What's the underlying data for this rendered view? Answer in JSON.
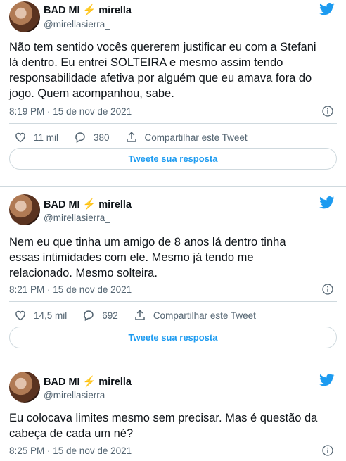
{
  "tweets": [
    {
      "display_name": "BAD MI",
      "emoji": "⚡",
      "display_name_suffix": "mirella",
      "handle": "@mirellasierra_",
      "text": "Não tem sentido vocês quererem justificar eu com a Stefani lá dentro. Eu entrei SOLTEIRA e mesmo assim tendo responsabilidade afetiva por alguém que eu amava fora do jogo. Quem acompanhou, sabe.",
      "timestamp": "8:19 PM · 15 de nov de 2021",
      "likes": "11 mil",
      "replies": "380",
      "share_label": "Compartilhar este Tweet",
      "reply_button": "Tweete sua resposta"
    },
    {
      "display_name": "BAD MI",
      "emoji": "⚡",
      "display_name_suffix": "mirella",
      "handle": "@mirellasierra_",
      "text": "Nem eu que tinha um amigo de 8 anos lá dentro tinha essas intimidades com ele. Mesmo já tendo me relacionado. Mesmo solteira.",
      "timestamp": "8:21 PM · 15 de nov de 2021",
      "likes": "14,5 mil",
      "replies": "692",
      "share_label": "Compartilhar este Tweet",
      "reply_button": "Tweete sua resposta"
    },
    {
      "display_name": "BAD MI",
      "emoji": "⚡",
      "display_name_suffix": "mirella",
      "handle": "@mirellasierra_",
      "text": "Eu colocava limites mesmo sem precisar. Mas é questão da cabeça de cada um né?",
      "timestamp": "8:25 PM · 15 de nov de 2021"
    }
  ],
  "colors": {
    "accent": "#1d9bf0",
    "twitter_blue": "#1d9bf0",
    "muted": "#536471",
    "border": "#cfd9de",
    "bolt": "#f4900c"
  }
}
